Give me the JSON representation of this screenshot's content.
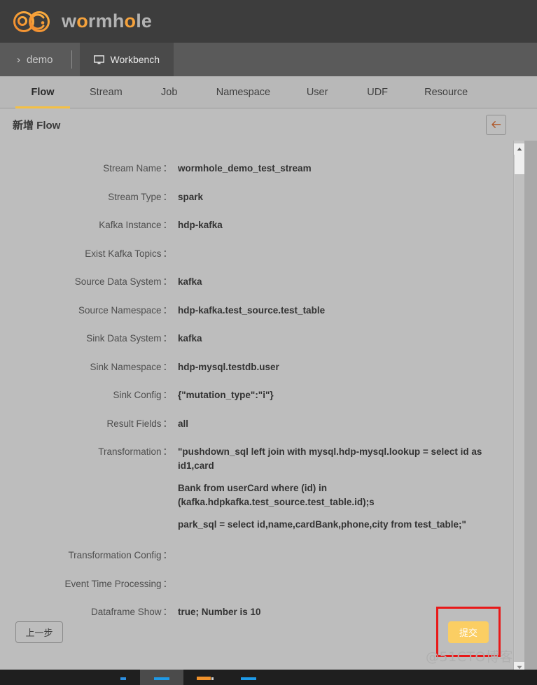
{
  "brand": {
    "name_prefix": "w",
    "name_highlight": "o",
    "name_suffix": "rmh",
    "name_highlight2": "o",
    "name_tail": "le",
    "full_name": "wormhole",
    "logo_color": "#f5a23c",
    "text_color": "#b3b3b3"
  },
  "project_bar": {
    "project_label": "demo",
    "chevron": "›",
    "workbench_label": "Workbench"
  },
  "nav": {
    "tabs": [
      {
        "label": "Flow",
        "active": true
      },
      {
        "label": "Stream",
        "active": false
      },
      {
        "label": "Job",
        "active": false
      },
      {
        "label": "Namespace",
        "active": false
      },
      {
        "label": "User",
        "active": false
      },
      {
        "label": "UDF",
        "active": false
      },
      {
        "label": "Resource",
        "active": false
      }
    ],
    "active_underline_color": "#f5c043"
  },
  "page": {
    "title": "新增 Flow",
    "back_button_label": "←"
  },
  "form": {
    "fields": [
      {
        "label": "Stream Name",
        "value": "wormhole_demo_test_stream"
      },
      {
        "label": "Stream Type",
        "value": "spark"
      },
      {
        "label": "Kafka Instance",
        "value": "hdp-kafka"
      },
      {
        "label": "Exist Kafka Topics",
        "value": ""
      },
      {
        "label": "Source Data System",
        "value": "kafka"
      },
      {
        "label": "Source Namespace",
        "value": "hdp-kafka.test_source.test_table"
      },
      {
        "label": "Sink Data System",
        "value": "kafka"
      },
      {
        "label": "Sink Namespace",
        "value": "hdp-mysql.testdb.user"
      },
      {
        "label": "Sink Config",
        "value": "{\"mutation_type\":\"i\"}"
      },
      {
        "label": "Result Fields",
        "value": "all"
      }
    ],
    "transformation": {
      "label": "Transformation",
      "lines": [
        "\"pushdown_sql left join with mysql.hdp-mysql.lookup = select id as id1,card",
        "Bank from userCard where (id) in (kafka.hdpkafka.test_source.test_table.id);s",
        "park_sql = select id,name,cardBank,phone,city from test_table;\""
      ]
    },
    "fields_after": [
      {
        "label": "Transformation Config",
        "value": ""
      },
      {
        "label": "Event Time Processing",
        "value": ""
      },
      {
        "label": "Dataframe Show",
        "value": "true; Number is 10"
      }
    ],
    "colon": "："
  },
  "footer": {
    "prev_label": "上一步",
    "submit_label": "提交",
    "submit_color": "#fbce63",
    "highlight_box_color": "#e81818"
  },
  "watermark": {
    "text": "@51CTO博客"
  },
  "scrollbar": {
    "up_arrow": "▲",
    "down_arrow": "▼"
  }
}
